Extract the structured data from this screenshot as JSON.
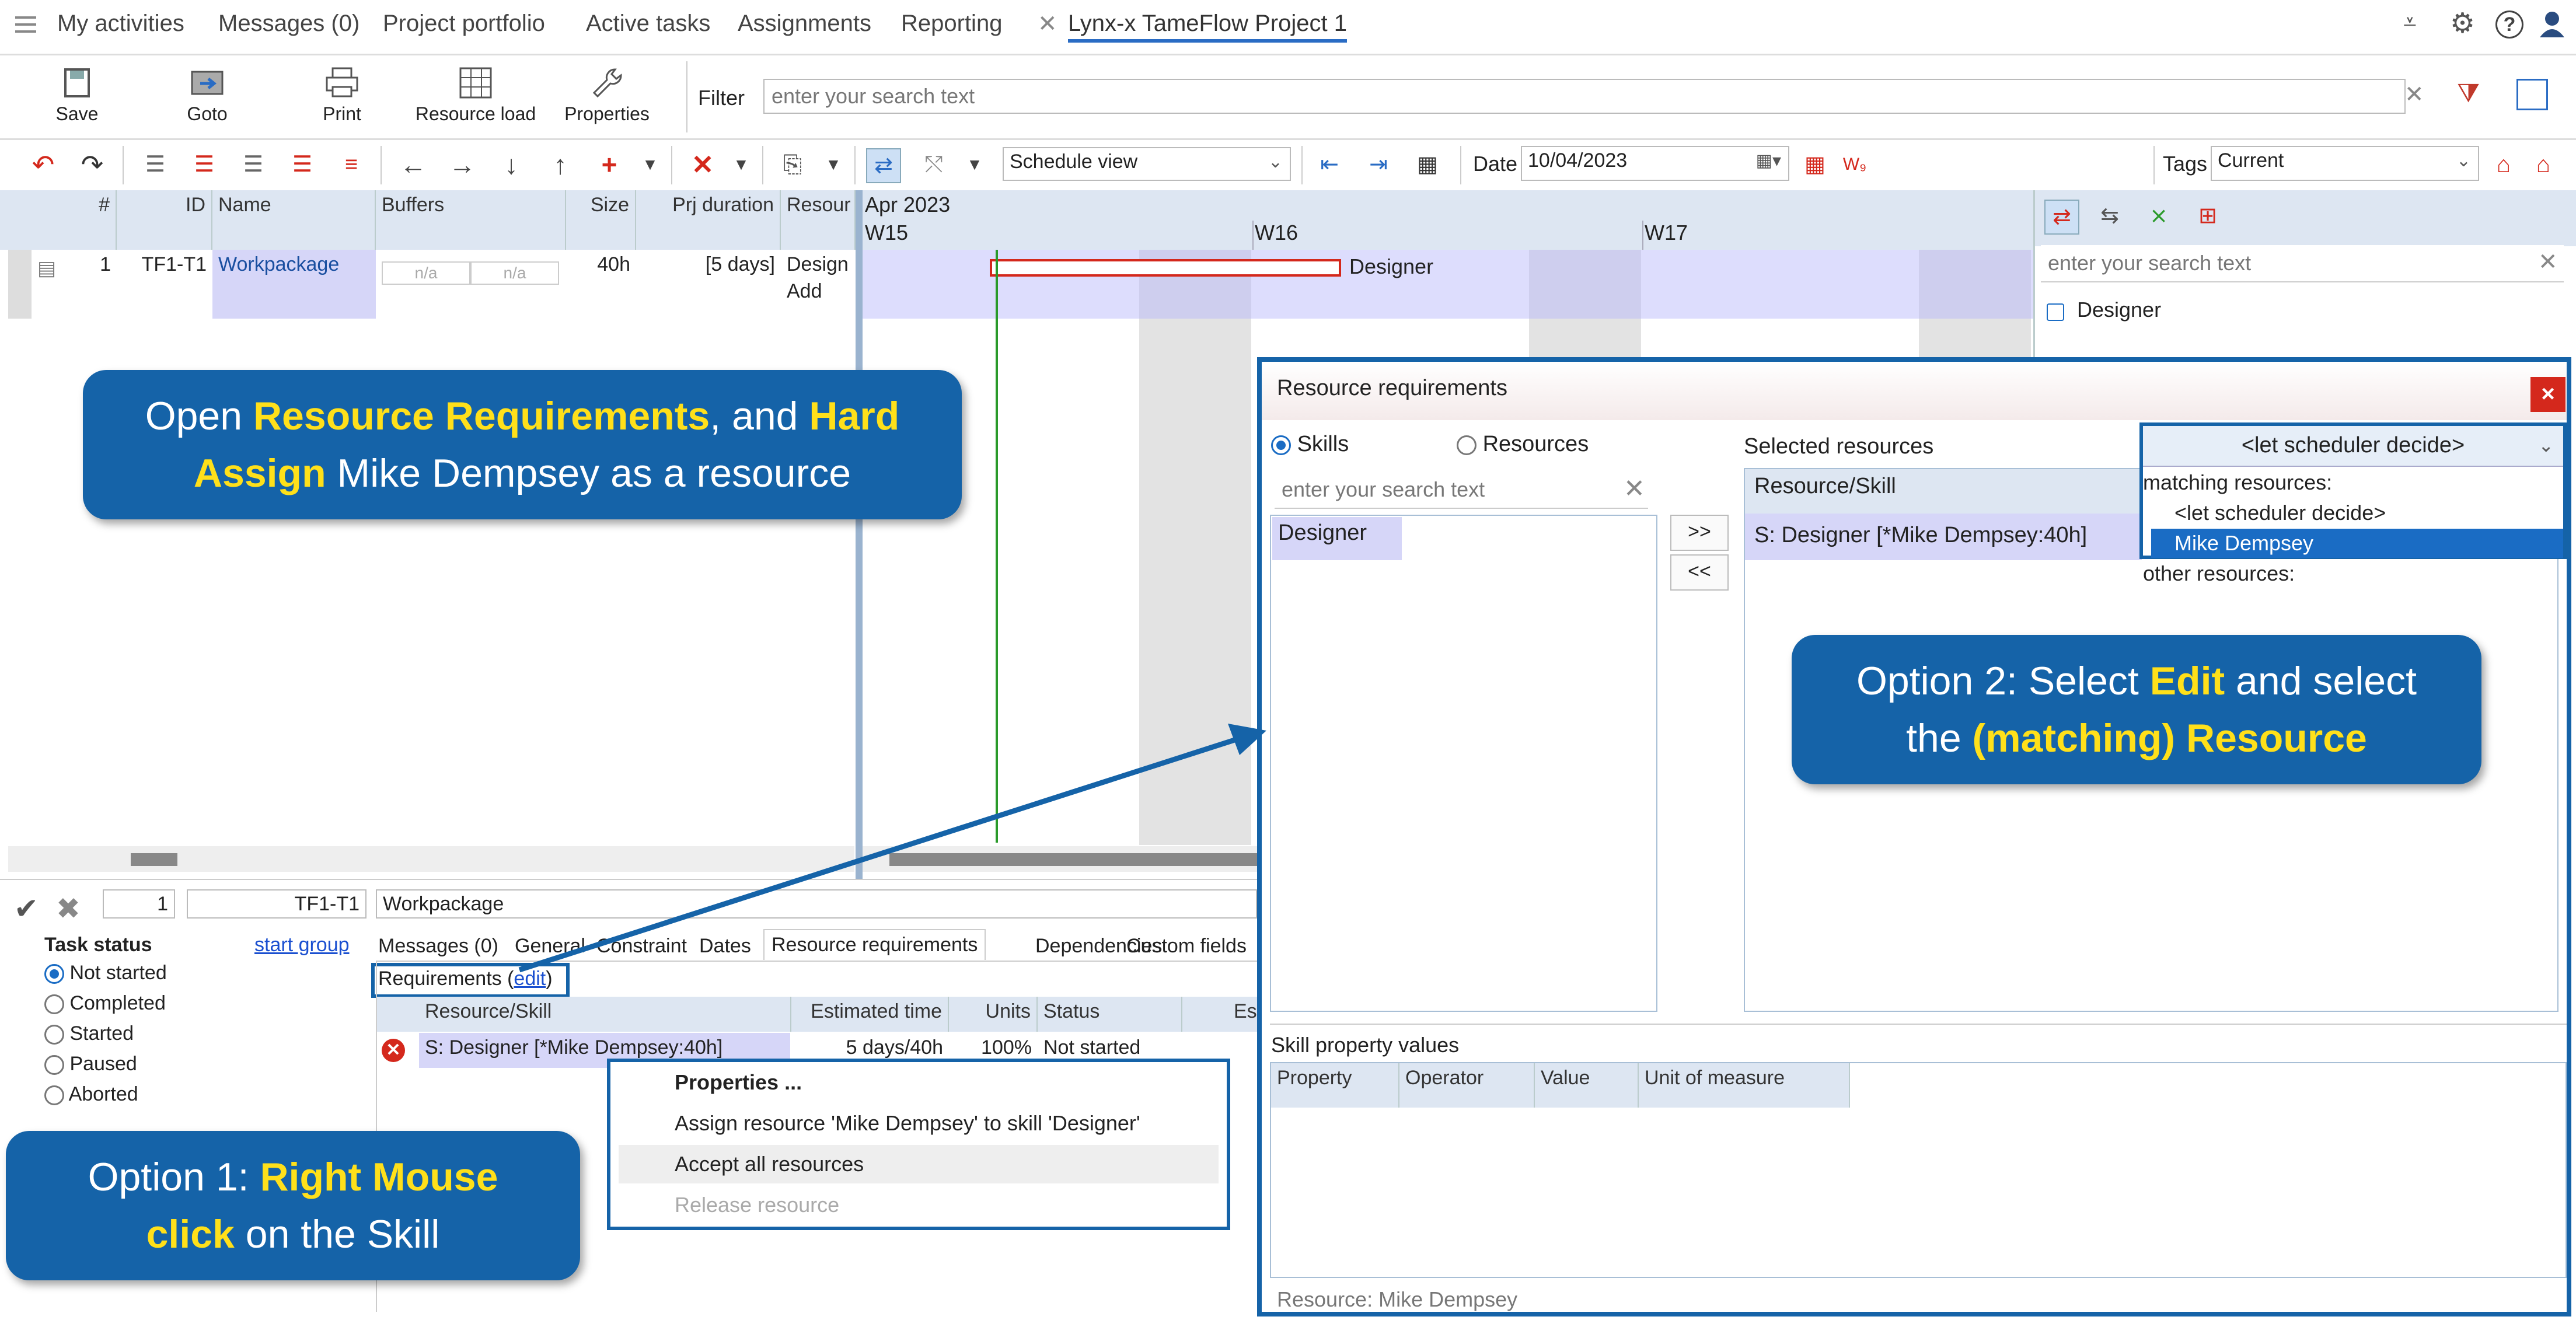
{
  "nav": {
    "items": [
      "My activities",
      "Messages (0)",
      "Project portfolio",
      "Active tasks",
      "Assignments",
      "Reporting"
    ],
    "active_tab": "Lynx-x TameFlow Project 1"
  },
  "toolbar": {
    "save": "Save",
    "goto": "Goto",
    "print": "Print",
    "resource_load": "Resource load",
    "properties": "Properties",
    "filter_label": "Filter",
    "filter_placeholder": "enter your search text",
    "view_select": "Schedule view",
    "date_label": "Date",
    "date_value": "10/04/2023",
    "tags_label": "Tags",
    "tags_value": "Current"
  },
  "grid": {
    "headers": {
      "num": "#",
      "id": "ID",
      "name": "Name",
      "buffers": "Buffers",
      "size": "Size",
      "prj_duration": "Prj duration",
      "resource": "Resour"
    },
    "row": {
      "num": "1",
      "id": "TF1-T1",
      "name": "Workpackage",
      "buffer1": "n/a",
      "buffer2": "n/a",
      "size": "40h",
      "duration": "[5 days]",
      "resource": "Design",
      "add": "Add"
    }
  },
  "gantt": {
    "month": "Apr 2023",
    "weeks": [
      "W15",
      "W16",
      "W17"
    ],
    "bar_label": "Designer"
  },
  "right_panel": {
    "search_placeholder": "enter your search text",
    "item": "Designer"
  },
  "detail": {
    "num": "1",
    "id": "TF1-T1",
    "name": "Workpackage",
    "task_status_label": "Task status",
    "start_group": "start group",
    "statuses": [
      "Not started",
      "Completed",
      "Started",
      "Paused",
      "Aborted"
    ],
    "tabs": [
      "Messages (0)",
      "General",
      "Constraint",
      "Dates",
      "Resource requirements",
      "Dependencies",
      "Custom fields"
    ],
    "requirements_label": "Requirements (",
    "requirements_edit": "edit",
    "requirements_close": ")",
    "table_headers": {
      "resource": "Resource/Skill",
      "est": "Estimated time",
      "units": "Units",
      "status": "Status",
      "es": "Es"
    },
    "table_row": {
      "resource": "S: Designer [*Mike Dempsey:40h]",
      "est": "5 days/40h",
      "units": "100%",
      "status": "Not started"
    }
  },
  "context_menu": {
    "items": [
      "Properties ...",
      "Assign resource 'Mike Dempsey' to skill 'Designer'",
      "Accept all resources",
      "Release resource"
    ]
  },
  "dialog": {
    "title": "Resource requirements",
    "close": "×",
    "skills": "Skills",
    "resources": "Resources",
    "search_placeholder": "enter your search text",
    "skill_item": "Designer",
    "add_btn": ">>",
    "remove_btn": "<<",
    "selected_label": "Selected resources",
    "selected_header": "Resource/Skill",
    "selected_row": "S: Designer [*Mike Dempsey:40h]",
    "dropdown_value": "<let scheduler decide>",
    "dropdown_options": {
      "matching_header": "matching resources:",
      "let": "<let scheduler decide>",
      "mike": "Mike Dempsey",
      "other_header": "other resources:"
    },
    "skill_property_label": "Skill property values",
    "prop_headers": {
      "property": "Property",
      "operator": "Operator",
      "value": "Value",
      "unit": "Unit of measure"
    },
    "status_text": "Resource: Mike Dempsey"
  },
  "callouts": {
    "c1_line1_a": "Open ",
    "c1_line1_b": "Resource Requirements",
    "c1_line1_c": ", and ",
    "c1_line1_d": "Hard",
    "c1_line2_a": "Assign",
    "c1_line2_b": " Mike Dempsey as a resource",
    "c2_line1_a": "Option 2: Select ",
    "c2_line1_b": "Edit",
    "c2_line1_c": " and select",
    "c2_line2_a": "the ",
    "c2_line2_b": "(matching) Resource",
    "c3_line1_a": "Option 1: ",
    "c3_line1_b": "Right Mouse",
    "c3_line2_a": "click",
    "c3_line2_b": " on the Skill"
  },
  "colors": {
    "callout": "#1563a8",
    "highlight": "#ffe01a",
    "accent": "#2a6cc4"
  }
}
